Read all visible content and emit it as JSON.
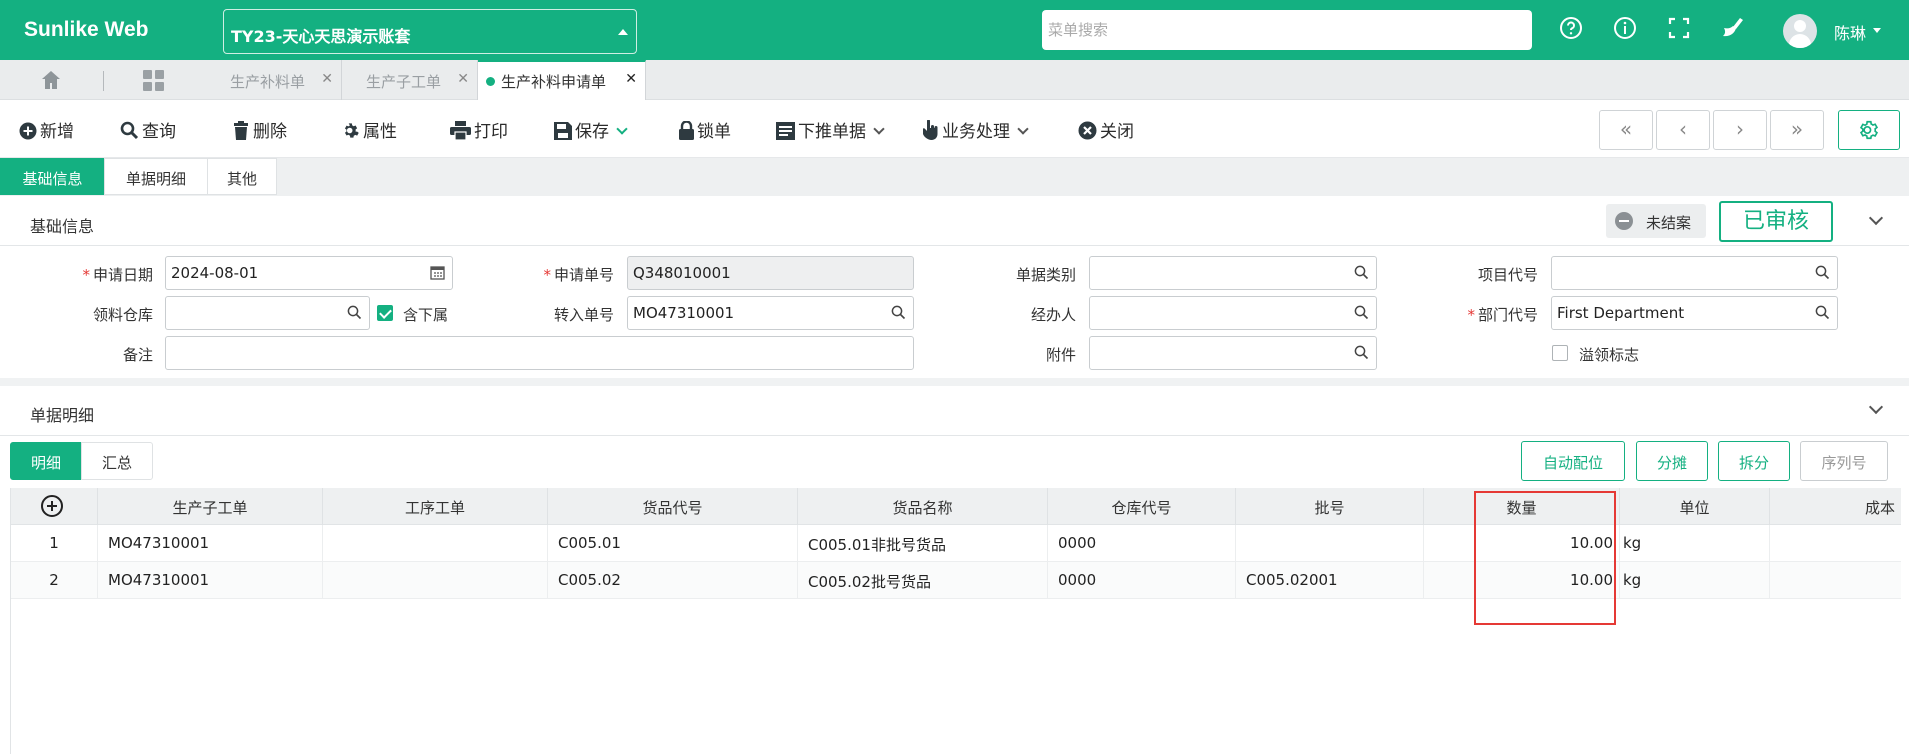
{
  "header": {
    "brand": "Sunlike Web",
    "account": "TY23-天心天思演示账套",
    "menu_search_placeholder": "菜单搜索",
    "user_name": "陈琳",
    "accent_color": "#14b081"
  },
  "page_tabs": [
    {
      "label": "生产补料单"
    },
    {
      "label": "生产子工单"
    },
    {
      "label": "生产补料申请单"
    }
  ],
  "toolbar": {
    "new": "新增",
    "query": "查询",
    "delete": "删除",
    "properties": "属性",
    "print": "打印",
    "save": "保存",
    "lock": "锁单",
    "push_down": "下推单据",
    "business": "业务处理",
    "close": "关闭"
  },
  "section_tabs": [
    "基础信息",
    "单据明细",
    "其他"
  ],
  "basic_info": {
    "title": "基础信息",
    "status_closed": "未结案",
    "status_approved": "已审核"
  },
  "form": {
    "apply_date_label": "申请日期",
    "apply_date": "2024-08-01",
    "apply_no_label": "申请单号",
    "apply_no": "Q348010001",
    "doc_type_label": "单据类别",
    "doc_type": "",
    "project_label": "项目代号",
    "project": "",
    "warehouse_label": "领料仓库",
    "warehouse": "",
    "include_sub_label": "含下属",
    "include_sub": true,
    "transfer_no_label": "转入单号",
    "transfer_no": "MO47310001",
    "handler_label": "经办人",
    "handler": "",
    "dept_label": "部门代号",
    "dept": "First Department",
    "remark_label": "备注",
    "remark": "",
    "attachment_label": "附件",
    "attachment": "",
    "overflow_label": "溢领标志",
    "overflow": false
  },
  "detail": {
    "title": "单据明细",
    "tabs": [
      "明细",
      "汇总"
    ],
    "buttons": {
      "auto_locate": "自动配位",
      "allocate": "分摊",
      "split": "拆分",
      "serial": "序列号"
    },
    "columns": [
      "生产子工单",
      "工序工单",
      "货品代号",
      "货品名称",
      "仓库代号",
      "批号",
      "数量",
      "单位",
      "成本"
    ],
    "rows": [
      {
        "no": "1",
        "work_order": "MO47310001",
        "process": "",
        "item_code": "C005.01",
        "item_name": "C005.01非批号货品",
        "warehouse": "0000",
        "batch": "",
        "qty": "10.00",
        "unit": "kg",
        "cost": ""
      },
      {
        "no": "2",
        "work_order": "MO47310001",
        "process": "",
        "item_code": "C005.02",
        "item_name": "C005.02批号货品",
        "warehouse": "0000",
        "batch": "C005.02001",
        "qty": "10.00",
        "unit": "kg",
        "cost": ""
      }
    ]
  }
}
